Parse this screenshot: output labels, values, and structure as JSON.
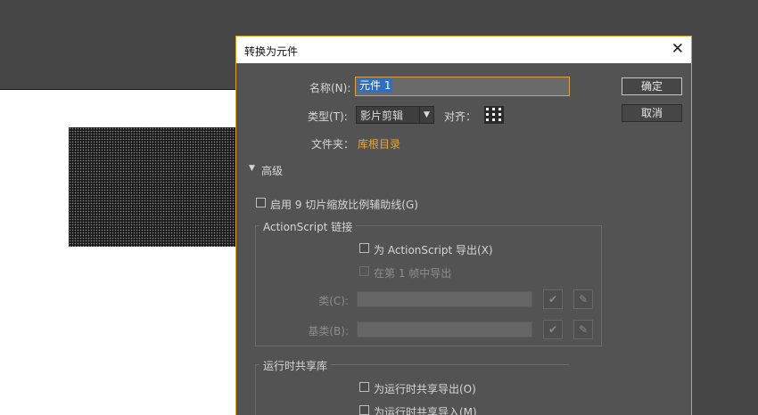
{
  "dialog": {
    "title": "转换为元件",
    "close_glyph": "✕",
    "name_label": "名称(N):",
    "name_value": "元件 1",
    "type_label": "类型(T):",
    "type_value": "影片剪辑",
    "align_label": "对齐：",
    "folder_label": "文件夹：",
    "folder_value": "库根目录",
    "ok_label": "确定",
    "cancel_label": "取消",
    "advanced_label": "高级",
    "advanced_arrow": "▼",
    "guides_label": "启用 9 切片缩放比例辅助线(G)"
  },
  "actionscript": {
    "legend": "ActionScript 链接",
    "export_label": "为 ActionScript 导出(X)",
    "frame1_label": "在第 1 帧中导出",
    "class_label": "类(C):",
    "base_class_label": "基类(B):",
    "check_glyph": "✔",
    "pencil_glyph": "✎"
  },
  "runtime": {
    "legend": "运行时共享库",
    "export_label": "为运行时共享导出(O)",
    "import_label": "为运行时共享导入(M)"
  }
}
